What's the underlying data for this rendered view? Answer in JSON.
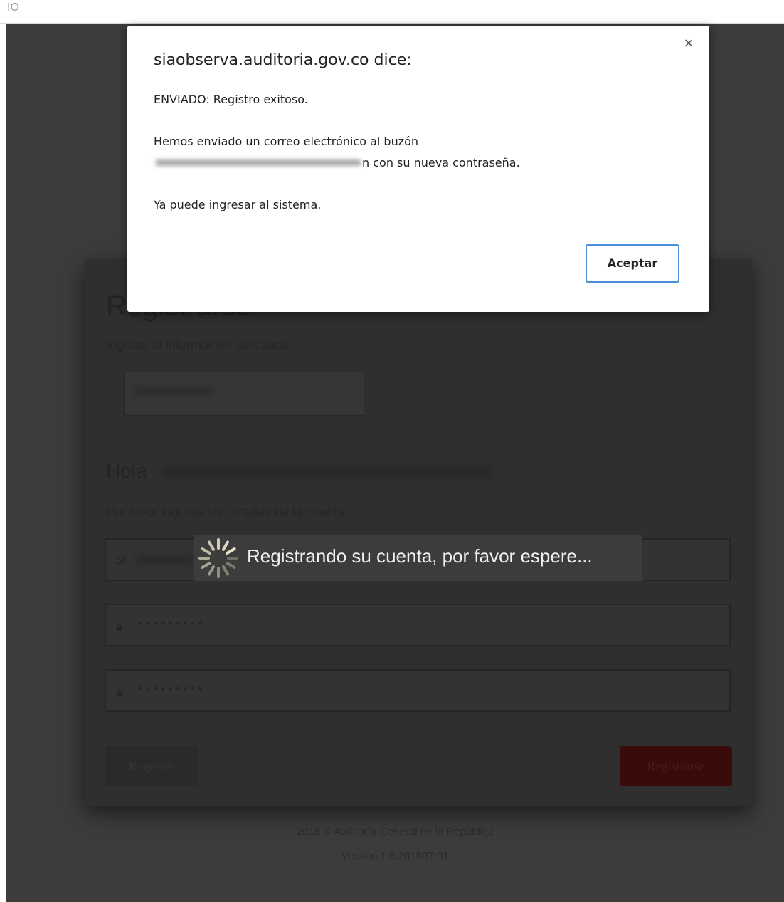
{
  "browser": {
    "top_fragment": "IO"
  },
  "dialog": {
    "title": "siaobserva.auditoria.gov.co dice:",
    "close_symbol": "×",
    "line1": "ENVIADO: Registro exitoso.",
    "line2": "Hemos enviado un correo electrónico al buzón",
    "line3_suffix": "n con su nueva contraseña.",
    "line4": "Ya puede ingresar al sistema.",
    "ok_label": "Aceptar"
  },
  "registration": {
    "title": "Registrarse",
    "subtitle": "Ingrese la información solicitada",
    "greeting": "Hola",
    "details_prompt": "Por favor ingrese los detalles de la cuenta",
    "email_icon": "envelope-icon",
    "lock_icon": "lock-icon",
    "password_mask": "•••••••••",
    "confirm_password_mask": "•••••••••",
    "back_label": "Regresar",
    "register_label": "Registrarse"
  },
  "loading": {
    "message": "Registrando su cuenta, por favor espere..."
  },
  "footer": {
    "copyright": "2018 © Auditoría General de la República",
    "version": "Versión 1.0.201807.01"
  },
  "colors": {
    "overlay": "#3c3c3c",
    "dialog_bg": "#ffffff",
    "ok_border": "#4a90d9",
    "register_button": "#3b0b0b"
  }
}
